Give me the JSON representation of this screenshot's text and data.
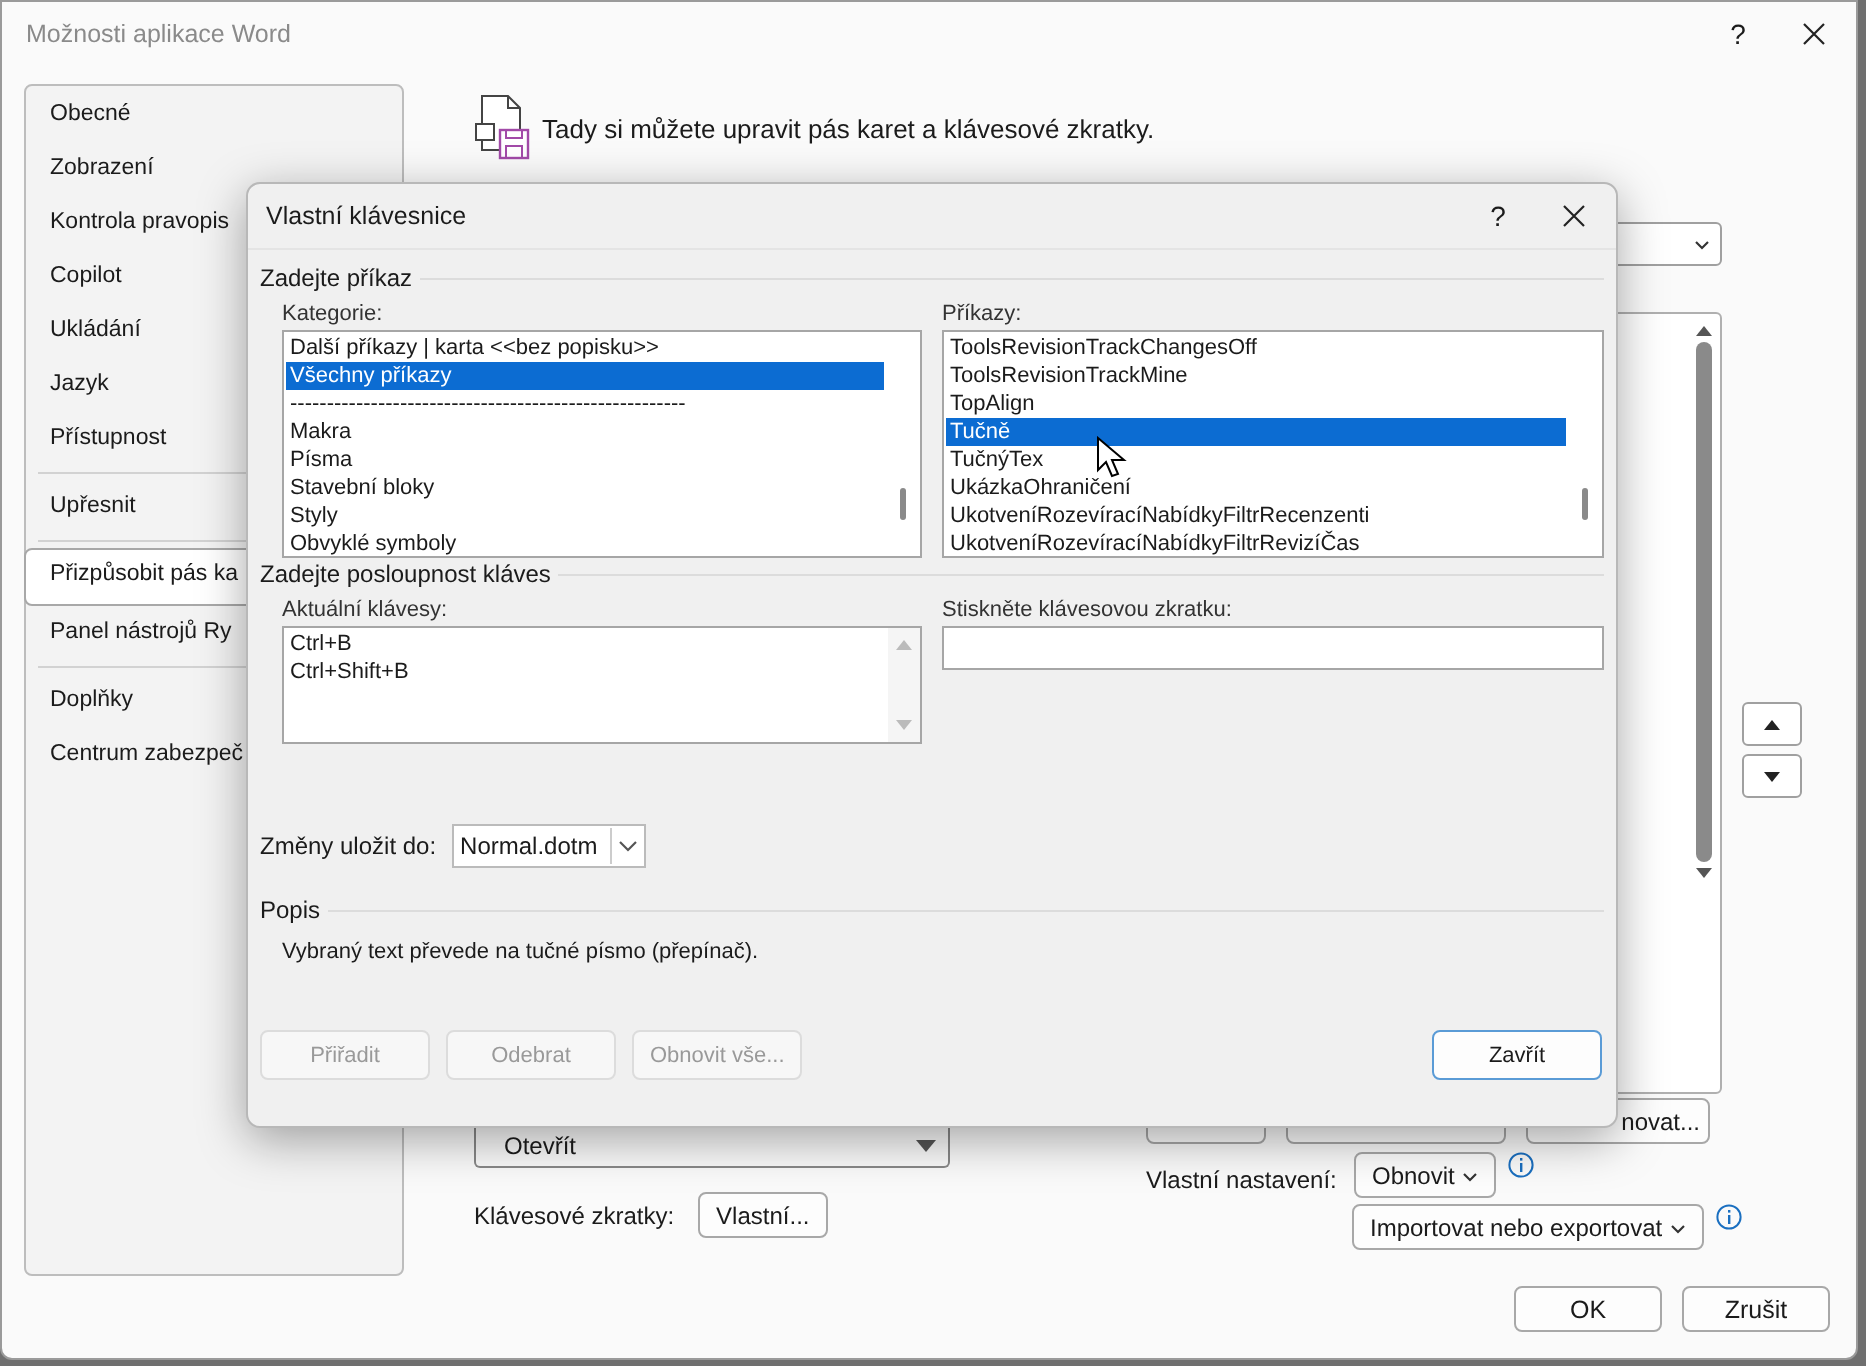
{
  "window": {
    "title": "Možnosti aplikace Word",
    "help": "?"
  },
  "sidebar": {
    "groups": [
      [
        {
          "label": "Obecné",
          "selected": false
        },
        {
          "label": "Zobrazení",
          "selected": false
        },
        {
          "label": "Kontrola pravopis",
          "selected": false
        },
        {
          "label": "Copilot",
          "selected": false
        },
        {
          "label": "Ukládání",
          "selected": false
        },
        {
          "label": "Jazyk",
          "selected": false
        },
        {
          "label": "Přístupnost",
          "selected": false
        }
      ],
      [
        {
          "label": "Upřesnit",
          "selected": false
        }
      ],
      [
        {
          "label": "Přizpůsobit pás ka",
          "selected": true
        },
        {
          "label": "Panel nástrojů Ry",
          "selected": false
        }
      ],
      [
        {
          "label": "Doplňky",
          "selected": false
        },
        {
          "label": "Centrum zabezpeč",
          "selected": false
        }
      ]
    ]
  },
  "header": {
    "text": "Tady si můžete upravit pás karet a klávesové zkratky."
  },
  "commands_list": {
    "items": [
      "Otevřít"
    ]
  },
  "shortcuts": {
    "label": "Klávesové zkratky:",
    "button": "Vlastní..."
  },
  "partial_button": {
    "label": "novat..."
  },
  "customizations": {
    "label": "Vlastní nastavení:",
    "reset_button": "Obnovit",
    "import_button": "Importovat nebo exportovat"
  },
  "footer_buttons": [
    "OK",
    "Zrušit"
  ],
  "dialog": {
    "title": "Vlastní klávesnice",
    "help": "?",
    "command_section": "Zadejte příkaz",
    "categories": {
      "label": "Kategorie:",
      "items": [
        {
          "label": "Další příkazy | karta <<bez popisku>>",
          "selected": false
        },
        {
          "label": "Všechny příkazy",
          "selected": true
        },
        {
          "label": "------------------------------------------------------",
          "selected": false
        },
        {
          "label": "Makra",
          "selected": false
        },
        {
          "label": "Písma",
          "selected": false
        },
        {
          "label": "Stavební bloky",
          "selected": false
        },
        {
          "label": "Styly",
          "selected": false
        },
        {
          "label": "Obvyklé symboly",
          "selected": false
        }
      ]
    },
    "commands": {
      "label": "Příkazy:",
      "items": [
        {
          "label": "ToolsRevisionTrackChangesOff",
          "selected": false
        },
        {
          "label": "ToolsRevisionTrackMine",
          "selected": false
        },
        {
          "label": "TopAlign",
          "selected": false
        },
        {
          "label": "Tučně",
          "selected": true
        },
        {
          "label": "TučnýTex",
          "selected": false
        },
        {
          "label": "UkázkaOhraničení",
          "selected": false
        },
        {
          "label": "UkotveníRozevíracíNabídkyFiltrRecenzenti",
          "selected": false
        },
        {
          "label": "UkotveníRozevíracíNabídkyFiltrRevizíČas",
          "selected": false
        }
      ]
    },
    "keys_section": "Zadejte posloupnost kláves",
    "current_keys": {
      "label": "Aktuální klávesy:",
      "items": [
        "Ctrl+B",
        "Ctrl+Shift+B"
      ]
    },
    "new_shortcut": {
      "label": "Stiskněte klávesovou zkratku:"
    },
    "save_in": {
      "label": "Změny uložit do:",
      "value": "Normal.dotm"
    },
    "description_section": "Popis",
    "description": "Vybraný text převede na tučné písmo (přepínač).",
    "buttons": [
      {
        "label": "Přiřadit",
        "disabled": true,
        "default": false
      },
      {
        "label": "Odebrat",
        "disabled": true,
        "default": false
      },
      {
        "label": "Obnovit vše...",
        "disabled": true,
        "default": false
      },
      {
        "label": "Zavřít",
        "disabled": false,
        "default": true
      }
    ]
  }
}
